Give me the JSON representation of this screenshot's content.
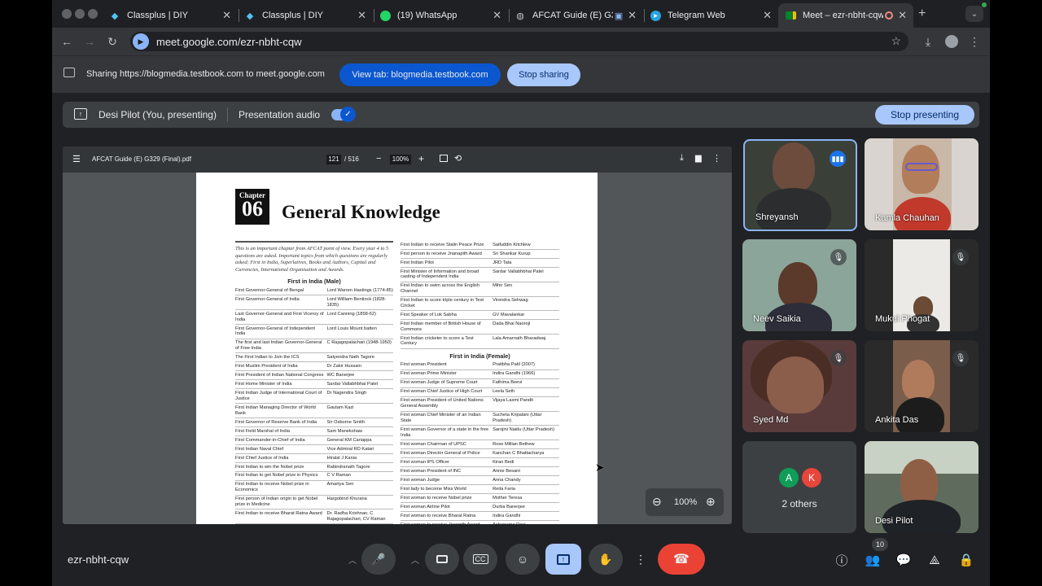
{
  "browser": {
    "tabs": [
      {
        "title": "Classplus | DIY",
        "icon": "classplus-icon"
      },
      {
        "title": "Classplus | DIY",
        "icon": "classplus-icon"
      },
      {
        "title": "(19) WhatsApp",
        "icon": "whatsapp-icon"
      },
      {
        "title": "AFCAT Guide (E) G3",
        "icon": "globe-icon"
      },
      {
        "title": "Telegram Web",
        "icon": "telegram-icon"
      },
      {
        "title": "Meet – ezr-nbht-cqw",
        "icon": "meet-icon",
        "active": true
      }
    ],
    "url": "meet.google.com/ezr-nbht-cqw"
  },
  "sharing_bar": {
    "text": "Sharing https://blogmedia.testbook.com to meet.google.com",
    "view_tab_label": "View tab: blogmedia.testbook.com",
    "stop_sharing_label": "Stop sharing"
  },
  "present_bar": {
    "presenter": "Desi Pilot (You, presenting)",
    "audio_label": "Presentation audio",
    "audio_on": true,
    "stop_presenting_label": "Stop presenting"
  },
  "pdf": {
    "title": "AFCAT Guide (E) G329 (Final).pdf",
    "page": "121",
    "page_total": "/ 516",
    "zoom": "100%",
    "chapter_word": "Chapter",
    "chapter_num": "06",
    "doc_title": "General Knowledge",
    "intro": "This is an important chapter from AFCAT point of view. Every year 4 to 5 questions are asked. Important topics from which questions are regularly asked; First in India, Superlatives, Books and Authors, Capital and Currencies, International Organisation and Awards.",
    "male_heading": "First in India (Male)",
    "male_rows": [
      [
        "First Governor-General of Bengal",
        "Lord Warren Hastings (1774-85)"
      ],
      [
        "First Governor-General of India",
        "Lord William Bentinck (1828-1835)"
      ],
      [
        "Last Governor-General and First Viceroy of India",
        "Lord Canning (1858-62)"
      ],
      [
        "First Governor-General of Independent India",
        "Lord Louis Mount batten"
      ],
      [
        "The first and last Indian Governor-General of Free India",
        "C Rajagopalachari (1948-1950)"
      ],
      [
        "The First Indian to Join the ICS",
        "Satyendra Nath Tagore"
      ],
      [
        "First Muslim President of India",
        "Dr Zakir Hussain"
      ],
      [
        "First President of Indian National Congress",
        "WC Banerjee"
      ],
      [
        "First Home Minister of India",
        "Sardar Vallabhbhai Patel"
      ],
      [
        "First Indian Judge of International Court of Justice",
        "Dr Nagendra Singh"
      ],
      [
        "First Indian Managing Director of World Bank",
        "Gautam Kazi"
      ],
      [
        "First Governor of Reserve Bank of India",
        "Sir Osborne Smith"
      ],
      [
        "First Field Marshal of India",
        "Sam Manekshaw"
      ],
      [
        "First Commander-in-Chief of India",
        "General KM Cariappa"
      ],
      [
        "First Indian Naval Chief",
        "Vice Admiral RD Katari"
      ],
      [
        "First Chief Justice of India",
        "Hiralal J Kania"
      ],
      [
        "First Indian to win the Nobel prize",
        "Rabindranath Tagore"
      ],
      [
        "First Indian to get Nobel prize in Physics",
        "C V Raman"
      ],
      [
        "First Indian to receive Nobel prize in Economics",
        "Amartya Sen"
      ],
      [
        "First person of Indian origin to get Nobel prize in Medicine",
        "Hargobind Khurana"
      ],
      [
        "First Indian to receive Bharat Ratna Award",
        "Dr. Radha Krishnan, C Rajagopalachari, CV Raman"
      ]
    ],
    "right_rows": [
      [
        "First Indian to receive Stalin Peace Prize",
        "Saifuddin Kitchlew"
      ],
      [
        "First person to receive Jnanapith Award",
        "Sri Shankar Kurup"
      ],
      [
        "First Indian Pilot",
        "JRD Tata"
      ],
      [
        "First Minister of Information and broad casting of Independent India",
        "Sardar Vallabhbhai Patel"
      ],
      [
        "First Indian to swim across the English Channel",
        "Mihir Sen"
      ],
      [
        "First Indian to score triple century in Test Cricket",
        "Virendra Sehwag"
      ],
      [
        "First Speaker of Lok Sabha",
        "GV Mavalankar"
      ],
      [
        "First Indian member of British House of Commons",
        "Dada Bhai Naoroji"
      ],
      [
        "First Indian cricketer to score a Test Century",
        "Lala Amarnath Bharadwaj"
      ]
    ],
    "female_heading": "First in India (Female)",
    "female_rows": [
      [
        "First woman President",
        "Pratibha Patil (2007)"
      ],
      [
        "First woman Prime Minister",
        "Indira Gandhi (1966)"
      ],
      [
        "First woman Judge of Supreme Court",
        "Fathima Beevi"
      ],
      [
        "First woman Chief Justice of High Court",
        "Leela Seth"
      ],
      [
        "First woman President of United Nations General Assembly",
        "Vijaya Laxmi Pandit"
      ],
      [
        "First woman Chief Minister of an Indian State",
        "Sucheta Kripalani (Uttar Pradesh)"
      ],
      [
        "First woman Governor of a state in the free India",
        "Sarojini Naidu (Uttar Pradesh)"
      ],
      [
        "First woman Chairman of UPSC",
        "Rose Millian Bethew"
      ],
      [
        "First woman Director General of Police",
        "Kanchan C Bhattacharya"
      ],
      [
        "First woman IPS Officer",
        "Kiran Bedi"
      ],
      [
        "First woman President of INC",
        "Annie Besant"
      ],
      [
        "First woman Judge",
        "Anna Chandy"
      ],
      [
        "First lady to become Miss World",
        "Reita Faria"
      ],
      [
        "First woman to receive Nobel prize",
        "Mother Teresa"
      ],
      [
        "First woman Airline Pilot",
        "Durba Banerjee"
      ],
      [
        "First woman to receive Bharat Ratna",
        "Indira Gandhi"
      ],
      [
        "First woman to receive Jnanpith Award",
        "Ashapurna Devi"
      ]
    ]
  },
  "presentation_zoom": "100%",
  "participants": [
    {
      "name": "Shreyansh",
      "speaking": true,
      "muted": false
    },
    {
      "name": "Kamla Chauhan",
      "speaking": false,
      "muted": false
    },
    {
      "name": "Neev Saikia",
      "speaking": false,
      "muted": true
    },
    {
      "name": "Mukul Phogat",
      "speaking": false,
      "muted": true
    },
    {
      "name": "Syed Md",
      "speaking": false,
      "muted": true
    },
    {
      "name": "Ankita Das",
      "speaking": false,
      "muted": true
    },
    {
      "name": "Desi Pilot",
      "speaking": false,
      "muted": false
    }
  ],
  "others": {
    "label": "2 others",
    "initials": [
      "A",
      "K"
    ],
    "colors": [
      "#0f9d58",
      "#e8453c"
    ]
  },
  "meeting_code": "ezr-nbht-cqw",
  "people_count": "10",
  "colors": {
    "accent": "#a8c7fa",
    "end_call": "#ea4335",
    "active_control": "#a8c7fa",
    "speaking_border": "#8ab4f8"
  }
}
